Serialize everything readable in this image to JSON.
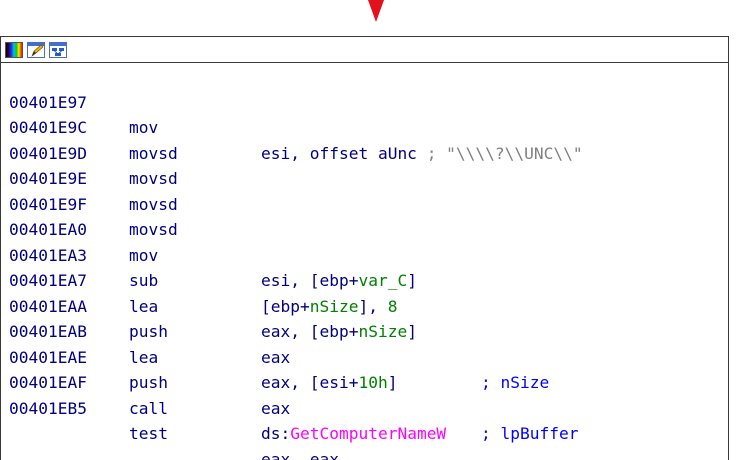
{
  "graph": {
    "incoming_arrow_color": "#e3101d",
    "header_icons": [
      "color-palette-icon",
      "edit-icon",
      "graph-view-icon"
    ]
  },
  "lines": [
    {
      "addr": "00401E97",
      "mn": "mov",
      "ops": "esi, offset aUnc",
      "comment": "; \"\\\\\\\\?\\\\UNC\\\\\""
    },
    {
      "addr": "00401E9C",
      "mn": "movsd",
      "ops": "",
      "comment": ""
    },
    {
      "addr": "00401E9D",
      "mn": "movsd",
      "ops": "",
      "comment": ""
    },
    {
      "addr": "00401E9E",
      "mn": "movsd",
      "ops": "",
      "comment": ""
    },
    {
      "addr": "00401E9F",
      "mn": "movsd",
      "ops": "",
      "comment": ""
    },
    {
      "addr": "00401EA0",
      "mn": "mov",
      "ops_a": "esi, [ebp+",
      "ops_var": "var_C",
      "ops_b": "]"
    },
    {
      "addr": "00401EA3",
      "mn": "sub",
      "ops_a": "[ebp+",
      "ops_var": "nSize",
      "ops_b": "], ",
      "ops_num": "8"
    },
    {
      "addr": "00401EA7",
      "mn": "lea",
      "ops_a": "eax, [ebp+",
      "ops_var": "nSize",
      "ops_b": "]"
    },
    {
      "addr": "00401EAA",
      "mn": "push",
      "ops": "eax",
      "comment": "; nSize"
    },
    {
      "addr": "00401EAB",
      "mn": "lea",
      "ops_a": "eax, [esi+",
      "ops_num": "10h",
      "ops_b": "]"
    },
    {
      "addr": "00401EAE",
      "mn": "push",
      "ops": "eax",
      "comment": "; lpBuffer"
    },
    {
      "addr": "00401EAF",
      "mn": "call",
      "ops_a": "ds:",
      "ops_api": "GetComputerNameW"
    },
    {
      "addr": "00401EB5",
      "mn": "test",
      "ops": "eax, eax"
    }
  ]
}
